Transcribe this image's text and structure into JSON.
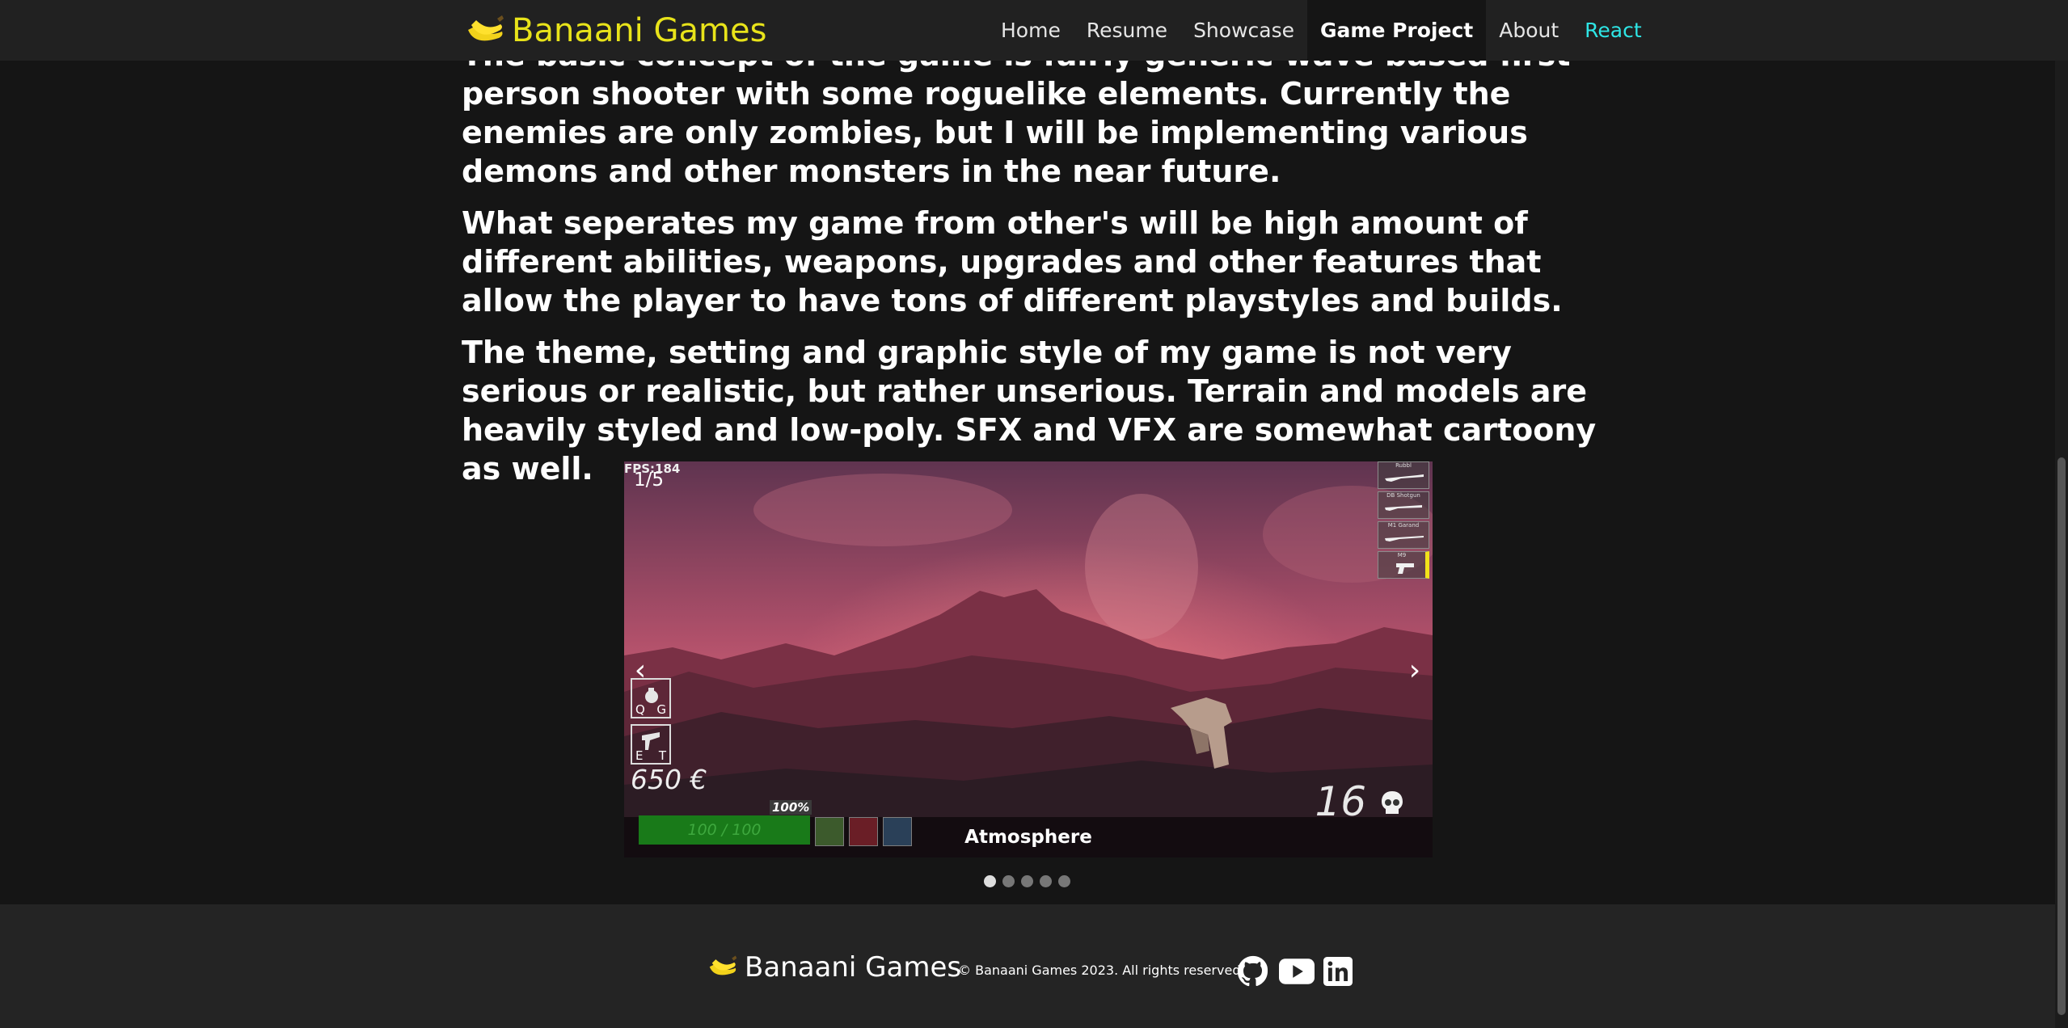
{
  "nav": {
    "brand": "Banaani Games",
    "links": [
      {
        "label": "Home"
      },
      {
        "label": "Resume"
      },
      {
        "label": "Showcase"
      },
      {
        "label": "Game Project"
      },
      {
        "label": "About"
      },
      {
        "label": "React"
      }
    ],
    "active_link": "Game Project",
    "brand_color": "#e8e31a",
    "react_color": "#2ee6e6"
  },
  "content": {
    "paragraphs": [
      "The basic concept of the game is fairly generic wave based first-person shooter with some roguelike elements. Currently the enemies are only zombies, but I will be implementing various demons and other monsters in the near future.",
      "What seperates my game from other's will be high amount of different abilities, weapons, upgrades and other features that allow the player to have tons of different playstyles and builds.",
      "The theme, setting and graphic style of my game is not very serious or realistic, but rather unserious. Terrain and models are heavily styled and low-poly. SFX and VFX are somewhat cartoony as well."
    ]
  },
  "carousel": {
    "caption": "Atmosphere",
    "prev_arrow": "‹",
    "next_arrow": "›",
    "slide_count": 5,
    "active_slide": 1,
    "hud": {
      "fps": "FPS:184",
      "wave": "1/5",
      "money": "650 €",
      "kills": "16",
      "health": "100 / 100",
      "percent": "100%",
      "ability_keys": [
        {
          "k1": "Q",
          "k2": "G"
        },
        {
          "k1": "E",
          "k2": "T"
        }
      ],
      "weapons": [
        "Rubbl",
        "DB Shotgun",
        "M1 Garand",
        "M9"
      ]
    }
  },
  "footer": {
    "brand": "Banaani Games",
    "copyright": "© Banaani Games 2023. All rights reserved",
    "social_icons": [
      "github-icon",
      "youtube-icon",
      "linkedin-icon"
    ]
  }
}
